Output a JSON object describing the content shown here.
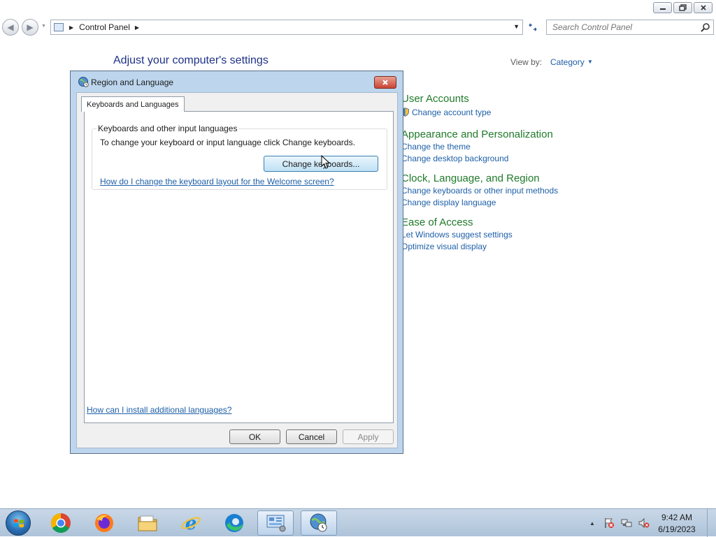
{
  "window": {
    "caption_buttons": [
      "minimize-icon",
      "restore-icon",
      "close-icon"
    ]
  },
  "navbar": {
    "address_segment": "Control Panel",
    "search_placeholder": "Search Control Panel"
  },
  "control_panel": {
    "title": "Adjust your computer's settings",
    "view_by_label": "View by:",
    "view_by_value": "Category",
    "categories": [
      {
        "heading": "User Accounts",
        "links": [
          "Change account type"
        ]
      },
      {
        "heading": "Appearance and Personalization",
        "links": [
          "Change the theme",
          "Change desktop background"
        ]
      },
      {
        "heading": "Clock, Language, and Region",
        "links": [
          "Change keyboards or other input methods",
          "Change display language"
        ]
      },
      {
        "heading": "Ease of Access",
        "links": [
          "Let Windows suggest settings",
          "Optimize visual display"
        ]
      }
    ]
  },
  "dialog": {
    "title": "Region and Language",
    "tab_label": "Keyboards and Languages",
    "group_title": "Keyboards and other input languages",
    "group_text": "To change your keyboard or input language click Change keyboards.",
    "change_keyboards_label": "Change keyboards...",
    "welcome_link": "How do I change the keyboard layout for the Welcome screen?",
    "install_link": "How can I install additional languages?",
    "ok_label": "OK",
    "cancel_label": "Cancel",
    "apply_label": "Apply"
  },
  "taskbar": {
    "pinned": [
      "chrome-icon",
      "firefox-icon",
      "file-explorer-icon",
      "internet-explorer-icon",
      "edge-icon",
      "control-panel-icon",
      "region-language-icon"
    ],
    "time": "9:42 AM",
    "date": "6/19/2023"
  },
  "colors": {
    "link": "#1e5fa8",
    "category_heading": "#1f7a2a",
    "page_title": "#1e3287",
    "dialog_frame": "#bdd6ee"
  }
}
